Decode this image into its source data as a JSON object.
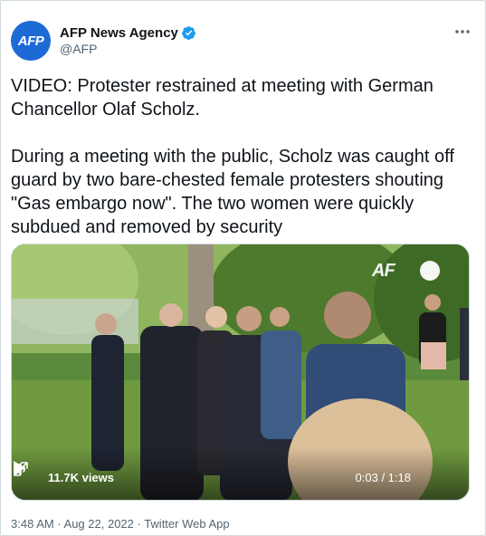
{
  "author": {
    "avatar_text": "AFP",
    "name": "AFP News Agency",
    "handle": "@AFP",
    "verified": true
  },
  "tweet": {
    "headline": "VIDEO: Protester restrained at meeting with German Chancellor Olaf Scholz.",
    "body": "During a meeting with the public, Scholz was caught off guard by two bare-chested female protesters shouting \"Gas embargo now\". The two women were quickly subdued and removed by security"
  },
  "video": {
    "watermark": "AF",
    "views": "11.7K views",
    "time": "0:03 / 1:18"
  },
  "footer": {
    "timestamp": "3:48 AM · Aug 22, 2022 · Twitter Web App"
  },
  "colors": {
    "accent": "#1d9bf0",
    "avatar_bg": "#1d6ad7",
    "secondary_text": "#536471"
  },
  "icons": [
    "verified-badge-icon",
    "more-icon",
    "play-icon",
    "volume-icon",
    "fullscreen-icon"
  ]
}
